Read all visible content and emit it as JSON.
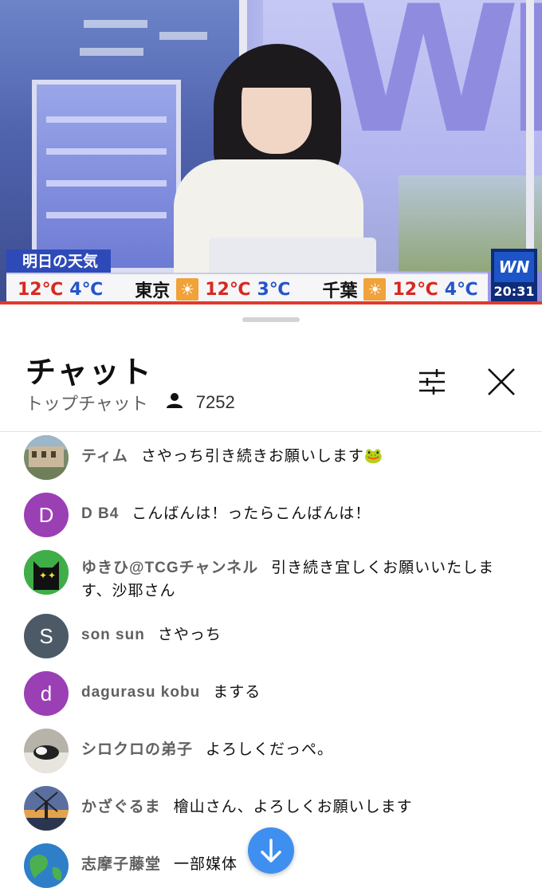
{
  "video": {
    "weather_label": "明日の天気",
    "ticker": [
      {
        "city": "",
        "high": "12℃",
        "low": "4℃"
      },
      {
        "city": "東京",
        "high": "12℃",
        "low": "3℃"
      },
      {
        "city": "千葉",
        "high": "12℃",
        "low": "4℃"
      }
    ],
    "logo_text": "WN",
    "clock": "20:31"
  },
  "chat": {
    "title": "チャット",
    "mode": "トップチャット",
    "viewer_count": "7252",
    "messages": [
      {
        "author": "ティム",
        "text": "さやっち引き続きお願いします🐸",
        "avatar_letter": "",
        "avatar_color": "#6d7e5c"
      },
      {
        "author": "D B4",
        "text": "こんばんは！ったらこんばんは！",
        "avatar_letter": "D",
        "avatar_color": "#9b3fb5"
      },
      {
        "author": "ゆきひ@TCGチャンネル",
        "text": "引き続き宜しくお願いいたします、沙耶さん",
        "avatar_letter": "",
        "avatar_color": "#3fae49"
      },
      {
        "author": "son sun",
        "text": "さやっち",
        "avatar_letter": "S",
        "avatar_color": "#4b5a66"
      },
      {
        "author": "dagurasu kobu",
        "text": "まする",
        "avatar_letter": "d",
        "avatar_color": "#9b3fb5"
      },
      {
        "author": "シロクロの弟子",
        "text": "よろしくだっぺ。",
        "avatar_letter": "",
        "avatar_color": "#8a8580"
      },
      {
        "author": "かざぐるま",
        "text": "檜山さん、よろしくお願いします",
        "avatar_letter": "",
        "avatar_color": "#4a5f8a"
      },
      {
        "author": "志摩子藤堂",
        "text": "一部媒体",
        "avatar_letter": "",
        "avatar_color": "#2e7fc8"
      }
    ]
  }
}
